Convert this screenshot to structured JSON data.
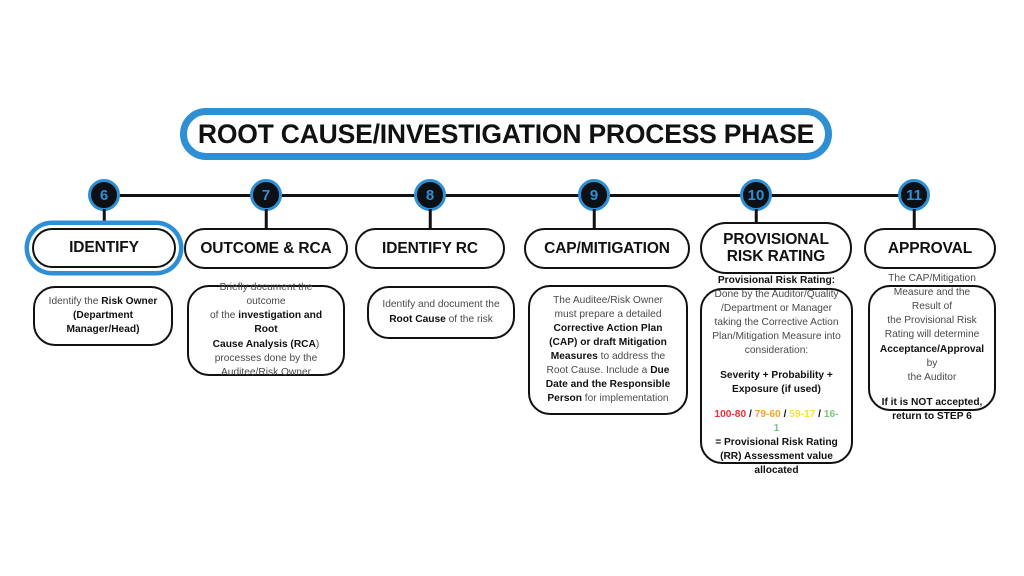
{
  "banner": {
    "title": "ROOT CAUSE/INVESTIGATION PROCESS PHASE"
  },
  "colors": {
    "accent_blue": "#2e8fd4",
    "ink": "#111111",
    "body_text": "#4a4a4a",
    "range_red": "#ee2d3a",
    "range_orange": "#f5a623",
    "range_yellow": "#f7e03c",
    "range_green": "#7bc67b"
  },
  "steps": [
    {
      "number": "6",
      "phase": "IDENTIFY",
      "highlighted": true,
      "card": {
        "line_1_plain": "Identify the ",
        "line_1_bold": "Risk Owner",
        "line_2_bold": "(Department",
        "line_3_bold": "Manager/Head)"
      }
    },
    {
      "number": "7",
      "phase": "OUTCOME & RCA",
      "highlighted": false,
      "card": {
        "p1": "Briefly document the outcome",
        "p2_plain": "of the ",
        "p2_bold": "investigation and Root",
        "p3_bold": "Cause Analysis (RCA",
        "p3_plain": ")",
        "p4": "processes done by the",
        "p5": "Auditee/Risk Owner"
      }
    },
    {
      "number": "8",
      "phase": "IDENTIFY RC",
      "highlighted": false,
      "card": {
        "p1": "Identify and  document the",
        "p2_bold": "Root Cause",
        "p2_plain": " of the risk"
      }
    },
    {
      "number": "9",
      "phase": "CAP/MITIGATION",
      "highlighted": false,
      "card": {
        "p1": "The Auditee/Risk Owner",
        "p2": "must prepare a detailed",
        "p3_bold": "Corrective Action Plan",
        "p4_bold": "(CAP) or draft Mitigation",
        "p5_bold": "Measures",
        "p5_plain": " to address the",
        "p6_plain": "Root Cause. Include a ",
        "p6_bold": "Due",
        "p7_bold": "Date and the Responsible",
        "p8_bold": "Person",
        "p8_plain": " for implementation"
      }
    },
    {
      "number": "10",
      "phase": "PROVISIONAL RISK RATING",
      "phase_line_1": "PROVISIONAL",
      "phase_line_2": "RISK RATING",
      "highlighted": false,
      "card": {
        "heading": "Provisional Risk Rating:",
        "p1": "Done by the Auditor/Quality",
        "p2": "/Department or Manager",
        "p3": "taking the Corrective Action",
        "p4": "Plan/Mitigation Measure into",
        "p5": "consideration:",
        "formula_1": "Severity + Probability +",
        "formula_2": "Exposure (if used)",
        "ranges": [
          {
            "label": "100-80",
            "color_key": "range_red"
          },
          {
            "label": "79-60",
            "color_key": "range_orange"
          },
          {
            "label": "59-17",
            "color_key": "range_yellow"
          },
          {
            "label": "16-1",
            "color_key": "range_green"
          }
        ],
        "range_separator": "/",
        "result_1": "= Provisional Risk Rating",
        "result_2": "(RR) Assessment value",
        "result_3": "allocated"
      }
    },
    {
      "number": "11",
      "phase": "APPROVAL",
      "highlighted": false,
      "card": {
        "p1": "The CAP/Mitigation",
        "p2": "Measure and the Result of",
        "p3": "the Provisional Risk",
        "p4": "Rating will determine",
        "p5_bold": "Acceptance/Approval",
        "p5_plain": " by",
        "p6": "the Auditor",
        "note_1": "If it is NOT accepted,",
        "note_2": "return to STEP 6"
      }
    }
  ]
}
